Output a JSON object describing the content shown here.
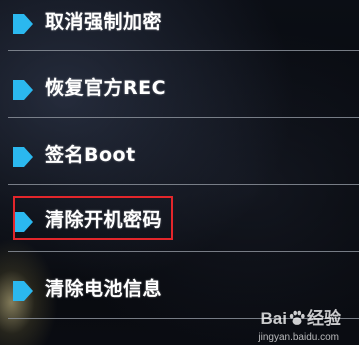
{
  "menu": {
    "items": [
      {
        "label": "取消强制加密",
        "icon": "arrow-right-icon"
      },
      {
        "label": "恢复官方REC",
        "icon": "arrow-right-icon"
      },
      {
        "label": "签名Boot",
        "icon": "arrow-right-icon"
      },
      {
        "label": "清除开机密码",
        "icon": "arrow-right-icon"
      },
      {
        "label": "清除电池信息",
        "icon": "arrow-right-icon"
      }
    ],
    "highlighted_index": 3
  },
  "colors": {
    "arrow": "#2bb8ef",
    "highlight_border": "#e3262b",
    "text": "#ffffff",
    "divider": "#8a8f99"
  },
  "watermark": {
    "text_before": "Bai",
    "text_after": "经验",
    "paw_icon": "baidu-paw-icon",
    "url": "jingyan.baidu.com"
  }
}
